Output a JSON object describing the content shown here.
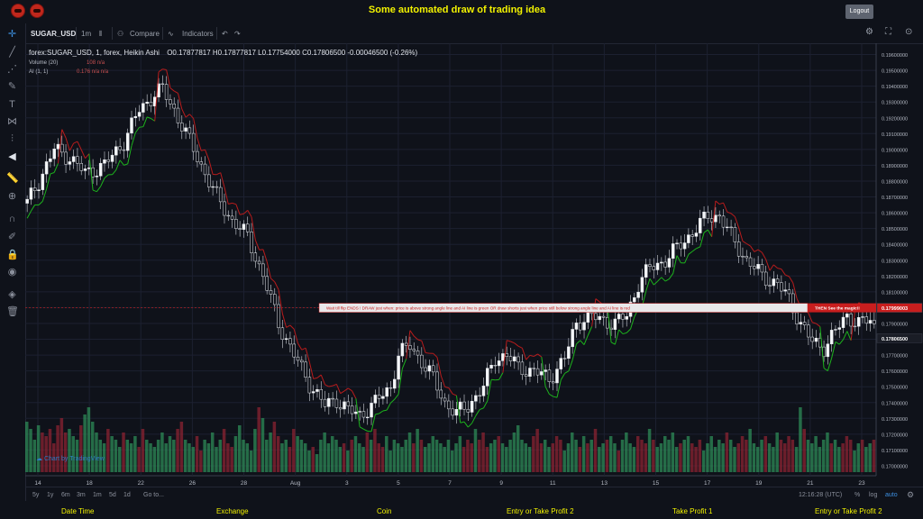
{
  "app": {
    "title": "Some automated draw of trading idea",
    "logout_label": "Logout"
  },
  "toolbar": {
    "symbol": "SUGAR_USD",
    "interval": "1m",
    "compare": "Compare",
    "indicators": "Indicators"
  },
  "legend": {
    "main": "forex:SUGAR_USD, 1, forex, Heikin Ashi",
    "ohlc": "O0.17877817  H0.17877817  L0.17754000  C0.17806500  -0.00046500 (-0.26%)",
    "volume": "Volume (20)",
    "volume_values": "108  n/a",
    "ai": "AI (1, 1)",
    "ai_values": "0.176  n/a  n/a"
  },
  "watermark": "Chart by TradingView",
  "bottombar": {
    "ranges": [
      "5y",
      "1y",
      "6m",
      "3m",
      "1m",
      "5d",
      "1d"
    ],
    "goto": "Go to...",
    "time": "12:16:28 (UTC)",
    "percent": "%",
    "log": "log",
    "auto": "auto"
  },
  "footer": {
    "items": [
      "Date Time",
      "Exchange",
      "Coin",
      "Entry or Take Profit 2",
      "Take Profit 1",
      "Entry or Take Profit 2"
    ]
  },
  "colors": {
    "up": "#2e8b57",
    "down": "#8b2332",
    "ai_up": "#1db31d",
    "ai_down": "#b81c1c",
    "accent": "#f2f200"
  },
  "chart_data": {
    "type": "candlestick",
    "x_ticks": [
      "14",
      "18",
      "22",
      "26",
      "28",
      "Aug",
      "3",
      "5",
      "7",
      "9",
      "11",
      "13",
      "15",
      "17",
      "19",
      "21",
      "23"
    ],
    "y_ticks": [
      "0.19600000",
      "0.19500000",
      "0.19400000",
      "0.19300000",
      "0.19200000",
      "0.19100000",
      "0.19000000",
      "0.18900000",
      "0.18800000",
      "0.18700000",
      "0.18600000",
      "0.18500000",
      "0.18400000",
      "0.18300000",
      "0.18200000",
      "0.18100000",
      "0.18000000",
      "0.17900000",
      "0.17800000",
      "0.17700000",
      "0.17600000",
      "0.17500000",
      "0.17400000",
      "0.17300000",
      "0.17200000",
      "0.17100000",
      "0.17000000"
    ],
    "ylim": [
      0.1696,
      0.1966
    ],
    "price_labels": [
      {
        "value": 0.17999,
        "text": "0.17999003",
        "color": "#c81e1e"
      },
      {
        "value": 0.178065,
        "text": "0.17806500",
        "color": "#1a1d26"
      }
    ],
    "price_path": [
      [
        0,
        0.1866
      ],
      [
        3,
        0.188
      ],
      [
        7,
        0.19
      ],
      [
        11,
        0.1895
      ],
      [
        15,
        0.1885
      ],
      [
        20,
        0.189
      ],
      [
        25,
        0.1905
      ],
      [
        29,
        0.1925
      ],
      [
        33,
        0.1935
      ],
      [
        35,
        0.1938
      ],
      [
        38,
        0.1925
      ],
      [
        42,
        0.1905
      ],
      [
        45,
        0.189
      ],
      [
        49,
        0.187
      ],
      [
        53,
        0.1855
      ],
      [
        57,
        0.1845
      ],
      [
        61,
        0.182
      ],
      [
        65,
        0.179
      ],
      [
        69,
        0.177
      ],
      [
        73,
        0.1752
      ],
      [
        77,
        0.1738
      ],
      [
        80,
        0.1742
      ],
      [
        83,
        0.1735
      ],
      [
        86,
        0.1732
      ],
      [
        90,
        0.174
      ],
      [
        94,
        0.175
      ],
      [
        96,
        0.177
      ],
      [
        99,
        0.1776
      ],
      [
        102,
        0.1766
      ],
      [
        105,
        0.1755
      ],
      [
        108,
        0.174
      ],
      [
        111,
        0.1733
      ],
      [
        114,
        0.1738
      ],
      [
        118,
        0.175
      ],
      [
        121,
        0.1768
      ],
      [
        124,
        0.177
      ],
      [
        127,
        0.1762
      ],
      [
        131,
        0.176
      ],
      [
        135,
        0.1755
      ],
      [
        139,
        0.1768
      ],
      [
        142,
        0.179
      ],
      [
        145,
        0.1795
      ],
      [
        149,
        0.1792
      ],
      [
        152,
        0.179
      ],
      [
        155,
        0.1795
      ],
      [
        158,
        0.1815
      ],
      [
        161,
        0.1825
      ],
      [
        165,
        0.183
      ],
      [
        169,
        0.184
      ],
      [
        173,
        0.185
      ],
      [
        176,
        0.1858
      ],
      [
        179,
        0.1858
      ],
      [
        182,
        0.1845
      ],
      [
        186,
        0.183
      ],
      [
        190,
        0.182
      ],
      [
        194,
        0.1815
      ],
      [
        197,
        0.1805
      ],
      [
        200,
        0.179
      ],
      [
        203,
        0.1778
      ],
      [
        206,
        0.1775
      ],
      [
        209,
        0.1785
      ],
      [
        212,
        0.1795
      ],
      [
        215,
        0.179
      ],
      [
        218,
        0.1792
      ],
      [
        220,
        0.1784
      ]
    ],
    "volume": [
      14,
      12,
      9,
      13,
      11,
      10,
      12,
      8,
      13,
      15,
      11,
      12,
      10,
      9,
      13,
      16,
      18,
      14,
      11,
      9,
      8,
      12,
      10,
      9,
      7,
      11,
      9,
      8,
      10,
      7,
      12,
      9,
      8,
      7,
      9,
      11,
      8,
      10,
      9,
      12,
      14,
      9,
      8,
      7,
      10,
      6,
      9,
      8,
      11,
      7,
      9,
      12,
      8,
      7,
      10,
      13,
      9,
      8,
      6,
      12,
      18,
      15,
      9,
      11,
      14,
      10,
      8,
      9,
      7,
      12,
      10,
      9,
      8,
      6,
      7,
      5,
      9,
      11,
      8,
      10,
      9,
      7,
      8,
      6,
      9,
      10,
      8,
      7,
      11,
      9,
      12,
      8,
      7,
      10,
      6,
      9,
      8,
      7,
      9,
      11,
      8,
      12,
      9,
      7,
      8,
      10,
      9,
      8,
      7,
      9,
      6,
      8,
      10,
      7,
      9,
      8,
      12,
      9,
      11,
      7,
      8,
      9,
      10,
      8,
      7,
      9,
      11,
      13,
      9,
      8,
      7,
      10,
      12,
      8,
      9,
      7,
      8,
      10,
      9,
      6,
      8,
      11,
      9,
      7,
      10,
      8,
      9,
      12,
      7,
      8,
      9,
      10,
      8,
      6,
      9,
      11,
      8,
      7,
      10,
      9,
      8,
      12,
      9,
      7,
      8,
      10,
      9,
      11,
      7,
      8,
      9,
      10,
      8,
      7,
      9,
      6,
      8,
      10,
      7,
      9,
      8,
      11,
      9,
      7,
      8,
      10,
      9,
      12,
      8,
      7,
      9,
      10,
      8,
      7,
      11,
      9,
      8,
      10,
      9,
      7,
      18,
      12,
      9,
      8,
      10,
      7,
      9,
      11,
      8,
      9,
      7,
      8,
      10,
      9,
      6,
      8,
      9,
      7,
      8,
      9
    ],
    "annotation": {
      "value": 0.17999,
      "text": "Wait till flip ENDS  !   DRAW just when:  price is above strong angle line and AI line is green      OR       draw shorts just when price still below strong angle line and AI line is red",
      "text_end": "THEN See the magic!!"
    }
  }
}
